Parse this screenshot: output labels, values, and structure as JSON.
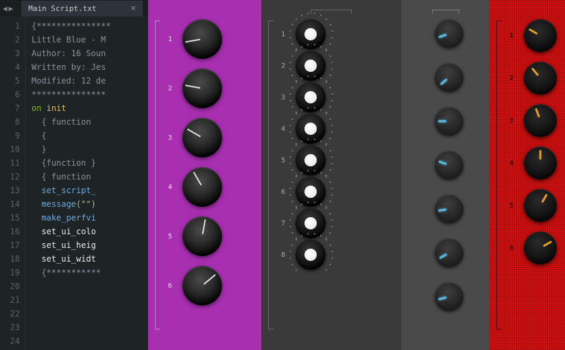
{
  "tab": {
    "title": "Main Script.txt"
  },
  "code": {
    "lines": [
      {
        "n": 1,
        "t": ""
      },
      {
        "n": 2,
        "t": "{***************"
      },
      {
        "n": 3,
        "t": "Little Blue - M"
      },
      {
        "n": 4,
        "t": "Author: 16 Soun"
      },
      {
        "n": 5,
        "t": "Written by: Jes"
      },
      {
        "n": 6,
        "t": "Modified: 12 de"
      },
      {
        "n": 7,
        "t": "***************"
      },
      {
        "n": 8,
        "kw1": "on",
        "kw2": "init"
      },
      {
        "n": 9,
        "t": "  { function "
      },
      {
        "n": 10,
        "t": "  {"
      },
      {
        "n": 11,
        "t": ""
      },
      {
        "n": 12,
        "t": "  }"
      },
      {
        "n": 13,
        "t": "  {function }"
      },
      {
        "n": 14,
        "t": ""
      },
      {
        "n": 15,
        "t": "  { function "
      },
      {
        "n": 16,
        "fn": "  set_script_"
      },
      {
        "n": 17,
        "fn": "  message",
        "str": "(\"\")"
      },
      {
        "n": 18,
        "fn": "  make_perfvi"
      },
      {
        "n": 19,
        "fn_w": "  set_ui_colo"
      },
      {
        "n": 20,
        "t": ""
      },
      {
        "n": 21,
        "fn_w": "  set_ui_heig"
      },
      {
        "n": 22,
        "fn_w": "  set_ui_widt"
      },
      {
        "n": 23,
        "t": ""
      },
      {
        "n": 24,
        "t": "  {***********"
      }
    ]
  },
  "panels": {
    "purple": {
      "knobs": [
        {
          "label": "1",
          "angle": -100
        },
        {
          "label": "2",
          "angle": -80
        },
        {
          "label": "3",
          "angle": -60
        },
        {
          "label": "4",
          "angle": -30
        },
        {
          "label": "5",
          "angle": 10
        },
        {
          "label": "6",
          "angle": 50
        }
      ]
    },
    "dark": {
      "knobs": [
        {
          "label": "1",
          "angle": 0
        },
        {
          "label": "2",
          "angle": 0
        },
        {
          "label": "3",
          "angle": 0
        },
        {
          "label": "4",
          "angle": 0
        },
        {
          "label": "5",
          "angle": 0
        },
        {
          "label": "6",
          "angle": 0
        },
        {
          "label": "7",
          "angle": 0
        },
        {
          "label": "8",
          "angle": 0
        }
      ]
    },
    "gray": {
      "knobs": [
        {
          "angle": -110
        },
        {
          "angle": -130
        },
        {
          "angle": -90
        },
        {
          "angle": -70
        },
        {
          "angle": -100
        },
        {
          "angle": -120
        },
        {
          "angle": -105
        }
      ]
    },
    "red": {
      "knobs": [
        {
          "label": "1",
          "angle": -60
        },
        {
          "label": "2",
          "angle": -40
        },
        {
          "label": "3",
          "angle": -20
        },
        {
          "label": "4",
          "angle": 0
        },
        {
          "label": "5",
          "angle": 30
        },
        {
          "label": "6",
          "angle": 60
        }
      ]
    }
  }
}
